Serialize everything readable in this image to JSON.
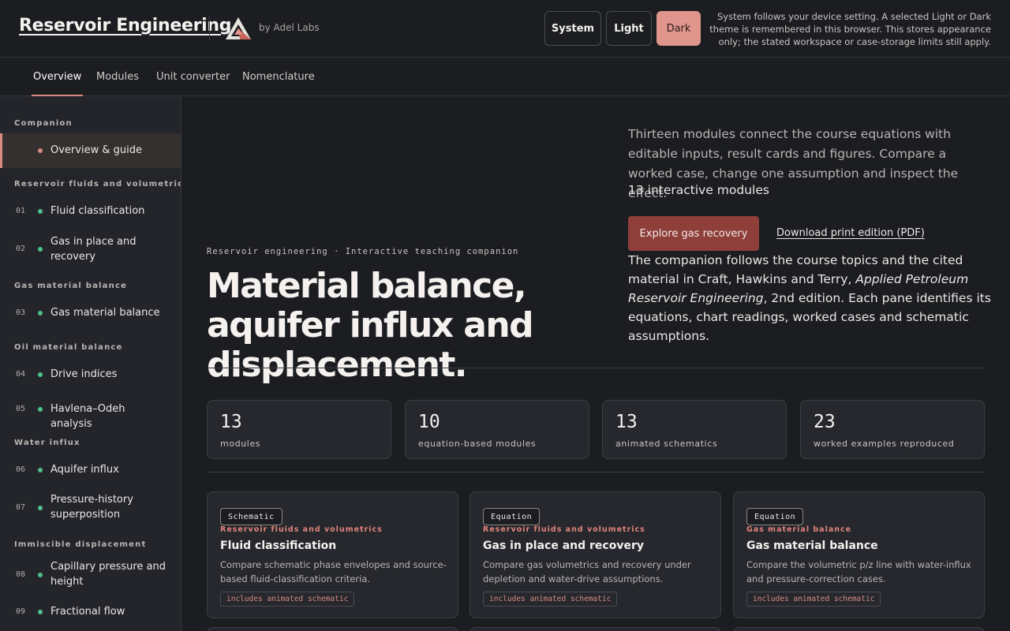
{
  "header": {
    "title": "Reservoir Engineering",
    "byline": "by Adel Labs",
    "logo_icon": "triangle-logo-icon",
    "theme_buttons": {
      "system": "System",
      "light": "Light",
      "dark": "Dark"
    },
    "selected_theme": "Dark",
    "theme_note": "System follows your device setting. A selected Light or Dark theme is remembered in this browser. This stores appearance only; the stated workspace or case-storage limits still apply."
  },
  "tabs": [
    {
      "label": "Overview",
      "active": true
    },
    {
      "label": "Modules"
    },
    {
      "label": "Unit converter"
    },
    {
      "label": "Nomenclature"
    }
  ],
  "sidebar": {
    "groups": {
      "companion": "Companion",
      "fluids": "Reservoir fluids and volumetrics",
      "gas_mb": "Gas material balance",
      "oil_mb": "Oil material balance",
      "water": "Water influx",
      "immiscible": "Immiscible displacement"
    },
    "items": [
      {
        "num": "",
        "label": "Overview & guide",
        "active": true
      },
      {
        "num": "01",
        "label": "Fluid classification"
      },
      {
        "num": "02",
        "label": "Gas in place and recovery"
      },
      {
        "num": "03",
        "label": "Gas material balance"
      },
      {
        "num": "04",
        "label": "Drive indices"
      },
      {
        "num": "05",
        "label": "Havlena–Odeh analysis"
      },
      {
        "num": "06",
        "label": "Aquifer influx"
      },
      {
        "num": "07",
        "label": "Pressure-history superposition"
      },
      {
        "num": "08",
        "label": "Capillary pressure and height"
      },
      {
        "num": "09",
        "label": "Fractional flow"
      }
    ]
  },
  "hero": {
    "eyebrow": "Reservoir engineering · Interactive teaching companion",
    "title": "Material balance, aquifer influx and displacement.",
    "intro": "Thirteen modules connect the course equations with editable inputs, result cards and figures. Compare a worked case, change one assumption and inspect the effect.",
    "modules_count": "13 interactive modules",
    "cta": "Explore gas recovery",
    "pdf_link": "Download print edition (PDF)",
    "cite_pre": "The companion follows the course topics and the cited material in Craft, Hawkins and Terry, ",
    "cite_book": "Applied Petroleum Reservoir Engineering",
    "cite_post": ", 2nd edition. Each pane identifies its equations, chart readings, worked cases and schematic assumptions."
  },
  "stats": [
    {
      "value": "13",
      "label": "modules"
    },
    {
      "value": "10",
      "label": "equation-based modules"
    },
    {
      "value": "13",
      "label": "animated schematics"
    },
    {
      "value": "23",
      "label": "worked examples reproduced"
    }
  ],
  "cards": [
    {
      "badge": "Schematic",
      "category": "Reservoir fluids and volumetrics",
      "title": "Fluid classification",
      "desc": "Compare schematic phase envelopes and source-based fluid-classification criteria.",
      "tag": "includes animated schematic"
    },
    {
      "badge": "Equation",
      "category": "Reservoir fluids and volumetrics",
      "title": "Gas in place and recovery",
      "desc": "Compare gas volumetrics and recovery under depletion and water-drive assumptions.",
      "tag": "includes animated schematic"
    },
    {
      "badge": "Equation",
      "category": "Gas material balance",
      "title": "Gas material balance",
      "desc": "Compare the volumetric p/z line with water-influx and pressure-correction cases.",
      "tag": "includes animated schematic"
    }
  ],
  "colors": {
    "accent": "#d98a82",
    "cta": "#8e3f3a",
    "dot": "#4fbf8c",
    "background": "#1c1d21",
    "sidebar": "#23252a"
  }
}
